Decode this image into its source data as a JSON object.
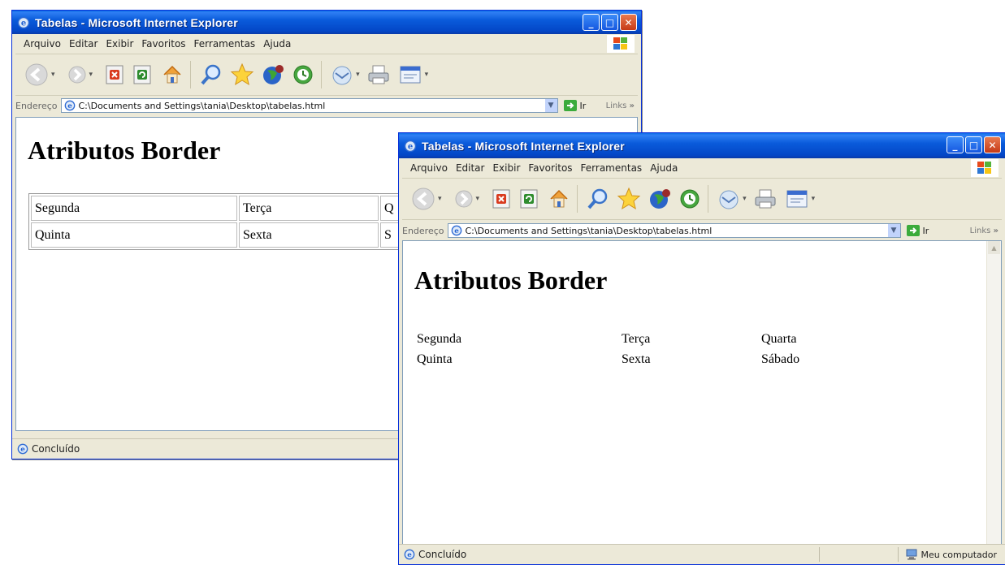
{
  "windows": [
    {
      "title": "Tabelas - Microsoft Internet Explorer",
      "menu": [
        "Arquivo",
        "Editar",
        "Exibir",
        "Favoritos",
        "Ferramentas",
        "Ajuda"
      ],
      "address_label": "Endereço",
      "address": "C:\\Documents and Settings\\tania\\Desktop\\tabelas.html",
      "go_label": "Ir",
      "links_label": "Links",
      "links_chevron": "»",
      "heading": "Atributos Border",
      "table": [
        [
          "Segunda",
          "Terça",
          "Q"
        ],
        [
          "Quinta",
          "Sexta",
          "S"
        ]
      ],
      "status": "Concluído"
    },
    {
      "title": "Tabelas - Microsoft Internet Explorer",
      "menu": [
        "Arquivo",
        "Editar",
        "Exibir",
        "Favoritos",
        "Ferramentas",
        "Ajuda"
      ],
      "address_label": "Endereço",
      "address": "C:\\Documents and Settings\\tania\\Desktop\\tabelas.html",
      "go_label": "Ir",
      "links_label": "Links",
      "links_chevron": "»",
      "heading": "Atributos Border",
      "table": [
        [
          "Segunda",
          "Terça",
          "Quarta"
        ],
        [
          "Quinta",
          "Sexta",
          "Sábado"
        ]
      ],
      "status": "Concluído",
      "zone": "Meu computador"
    }
  ],
  "toolbar_icons": [
    "back-icon",
    "forward-icon",
    "stop-icon",
    "refresh-icon",
    "home-icon",
    "search-icon",
    "favorites-icon",
    "media-icon",
    "history-icon",
    "mail-icon",
    "print-icon",
    "edit-icon"
  ],
  "colors": {
    "titlebar": "#0a5bdb",
    "chrome": "#ece9d8",
    "close_button": "#c63a16"
  }
}
